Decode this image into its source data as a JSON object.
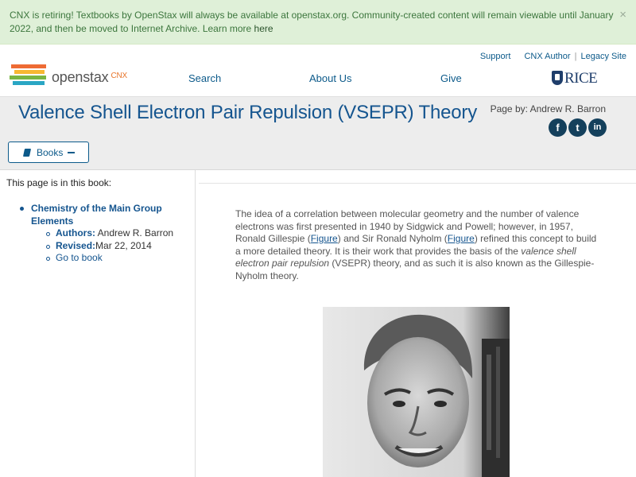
{
  "alert": {
    "text_before_link": "CNX is retiring! Textbooks by OpenStax will always be available at openstax.org. Community-created content will remain viewable until January 2022, and then be moved to Internet Archive. Learn more ",
    "link": "here",
    "close": "×"
  },
  "utility_nav": {
    "support": "Support",
    "cnx_author": "CNX Author",
    "separator": "|",
    "legacy_site": "Legacy Site"
  },
  "logo": {
    "openstax": "openstax",
    "cnx": "CNX"
  },
  "nav": {
    "search": "Search",
    "about": "About Us",
    "give": "Give"
  },
  "rice": {
    "word": "RICE"
  },
  "page": {
    "title": "Valence Shell Electron Pair Repulsion (VSEPR) Theory",
    "byline": "Page by: Andrew R. Barron",
    "social": {
      "facebook": "f",
      "twitter": "t",
      "linkedin": "in"
    },
    "books_button": "Books"
  },
  "sidebar": {
    "intro": "This page is in this book:",
    "book_title": "Chemistry of the Main Group Elements",
    "authors_label": "Authors:",
    "authors_value": " Andrew R. Barron",
    "revised_label": "Revised:",
    "revised_value": "Mar 22, 2014",
    "go_to_book": "Go to book"
  },
  "content": {
    "p1": "The idea of a correlation between molecular geometry and the number of valence electrons was first presented in 1940 by Sidgwick and Powell; however, in 1957, Ronald Gillespie (",
    "figure1": "Figure",
    "p2": ") and Sir Ronald Nyholm (",
    "figure2": "Figure",
    "p3": ") refined this concept to build a more detailed theory. It is their work that provides the basis of the ",
    "p_italic": "valence shell electron pair repulsion",
    "p4": " (VSEPR) theory, and as such it is also known as the Gillespie-Nyholm theory."
  },
  "colors": {
    "alert_bg": "#dff0d8",
    "alert_text": "#3c763d",
    "link_blue": "#0c5a8a",
    "title_blue": "#15558f",
    "titlebar_bg": "#ededed",
    "logo_bars": [
      "#ee6b34",
      "#f6b832",
      "#79b543",
      "#2aa6c4",
      "#243f7a"
    ]
  }
}
